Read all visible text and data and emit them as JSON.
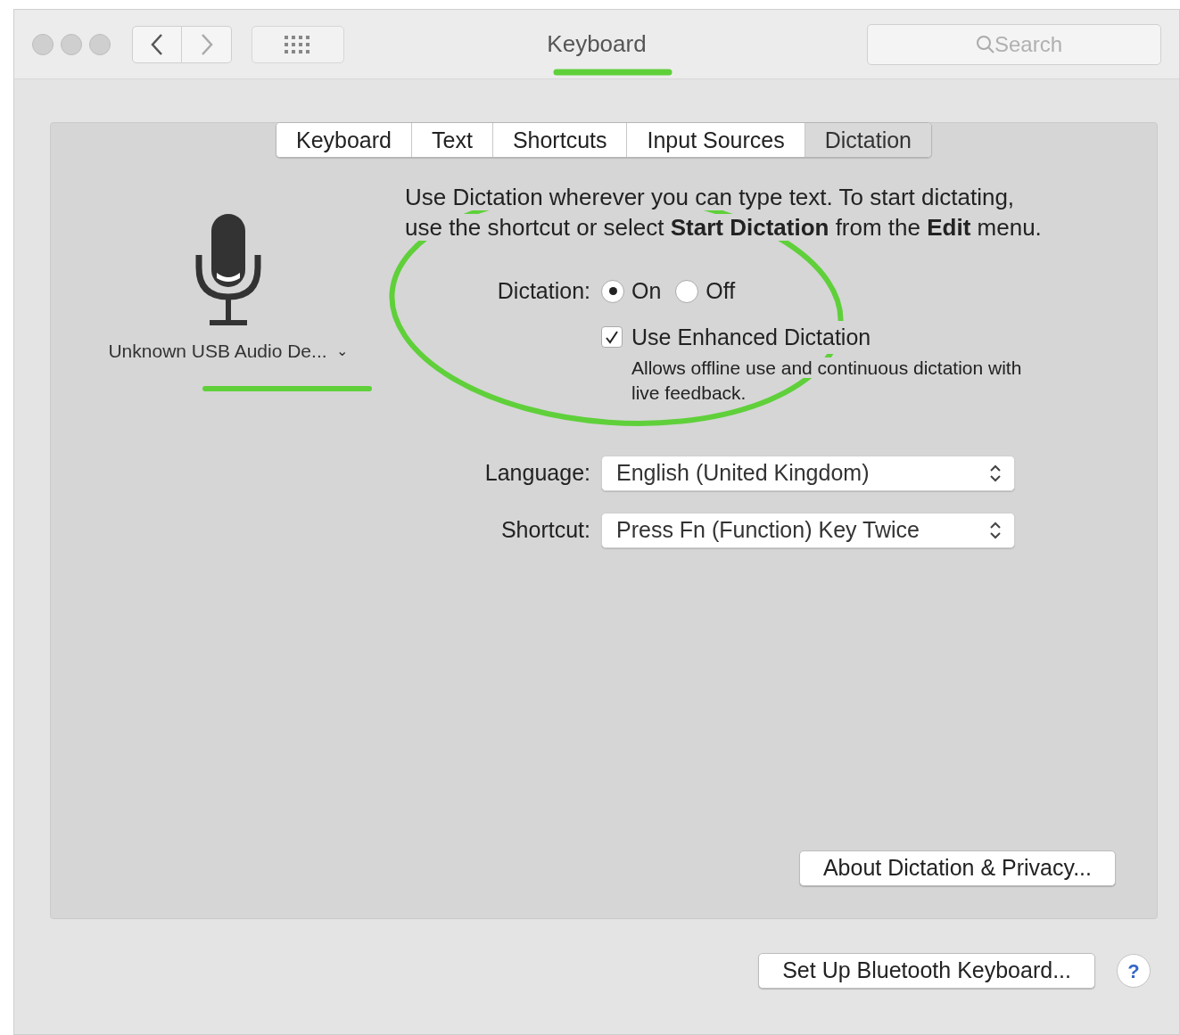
{
  "window": {
    "title": "Keyboard",
    "search": {
      "placeholder": "Search"
    }
  },
  "tabs": [
    {
      "label": "Keyboard",
      "selected": false
    },
    {
      "label": "Text",
      "selected": false
    },
    {
      "label": "Shortcuts",
      "selected": false
    },
    {
      "label": "Input Sources",
      "selected": false
    },
    {
      "label": "Dictation",
      "selected": true
    }
  ],
  "microphone": {
    "label": "Unknown USB Audio De...",
    "chevron": "⌄"
  },
  "description": [
    "Use Dictation wherever you can type text. To start dictating,",
    "use the shortcut or select **Start Dictation** from the **Edit** menu."
  ],
  "dictation": {
    "label": "Dictation:",
    "options": [
      {
        "label": "On",
        "selected": true
      },
      {
        "label": "Off",
        "selected": false
      }
    ]
  },
  "enhanced": {
    "label": "Use Enhanced Dictation",
    "checked": true,
    "note": [
      "Allows offline use and continuous dictation with",
      "live feedback."
    ]
  },
  "selects": [
    {
      "label": "Language:",
      "value": "English (United Kingdom)"
    },
    {
      "label": "Shortcut:",
      "value": "Press Fn (Function) Key Twice"
    }
  ],
  "panel_button": "About Dictation & Privacy...",
  "footer_button": "Set Up Bluetooth Keyboard...",
  "help": "?"
}
